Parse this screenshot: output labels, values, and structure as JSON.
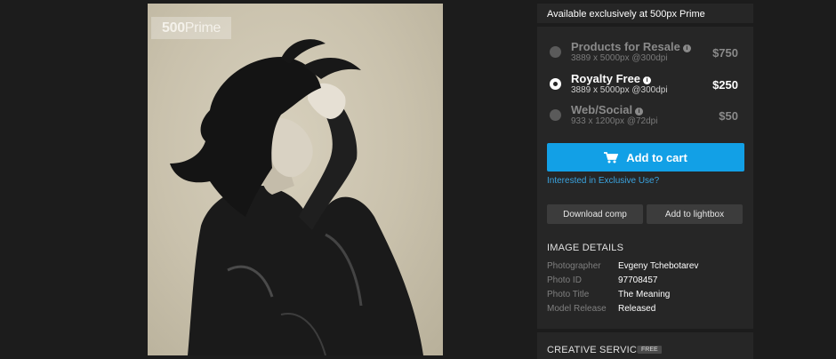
{
  "watermark": {
    "num": "500",
    "word": "Prime"
  },
  "header": {
    "title": "Available exclusively at 500px Prime"
  },
  "licenses": [
    {
      "name": "Products for Resale",
      "dims": "3889 x 5000px @300dpi",
      "price": "$750",
      "selected": false
    },
    {
      "name": "Royalty Free",
      "dims": "3889 x 5000px @300dpi",
      "price": "$250",
      "selected": true
    },
    {
      "name": "Web/Social",
      "dims": "933 x 1200px @72dpi",
      "price": "$50",
      "selected": false
    }
  ],
  "actions": {
    "add_to_cart": "Add to cart",
    "exclusive_link": "Interested in Exclusive Use?",
    "download_comp": "Download comp",
    "add_to_lightbox": "Add to lightbox"
  },
  "details": {
    "title": "IMAGE DETAILS",
    "rows": [
      {
        "key": "Photographer",
        "value": "Evgeny Tchebotarev"
      },
      {
        "key": "Photo ID",
        "value": "97708457"
      },
      {
        "key": "Photo Title",
        "value": "The Meaning"
      },
      {
        "key": "Model Release",
        "value": "Released"
      }
    ]
  },
  "creative": {
    "title": "CREATIVE SERVICES",
    "badge": "FREE"
  },
  "icons": {
    "info": "info-icon",
    "cart": "shopping-cart-icon",
    "radio": "radio-button"
  },
  "colors": {
    "accent": "#12a0e6",
    "link": "#3aa4e0",
    "panel": "#262626",
    "background": "#1c1c1c"
  }
}
